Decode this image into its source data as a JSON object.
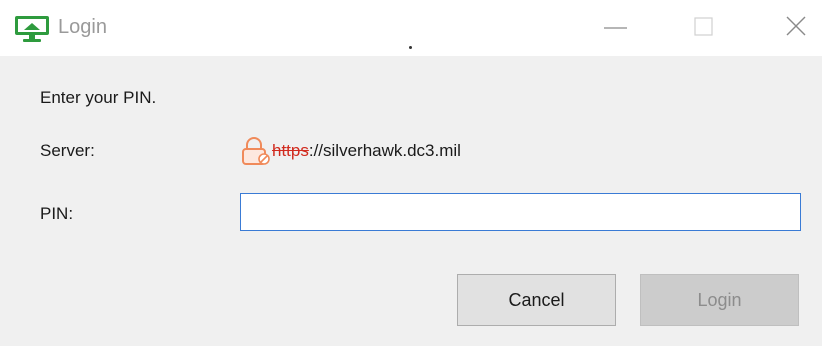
{
  "window": {
    "title": "Login",
    "controls": {
      "minimize_icon": "minimize-icon",
      "maximize_icon": "maximize-icon",
      "close_icon": "close-icon",
      "maximize_state": "disabled"
    }
  },
  "form": {
    "prompt": "Enter your PIN.",
    "server_label": "Server:",
    "server_url_scheme": "https",
    "server_url_rest": "://silverhawk.dc3.mil",
    "server_icon": "broken-lock-icon",
    "pin_label": "PIN:",
    "pin_value": "",
    "pin_placeholder": ""
  },
  "buttons": {
    "cancel_label": "Cancel",
    "login_label": "Login",
    "login_state": "disabled"
  },
  "colors": {
    "accent_border": "#3a7bd5",
    "insecure_scheme": "#d12b1f",
    "lock_orange": "#f08a5a",
    "app_icon_green": "#2e9b3e"
  }
}
